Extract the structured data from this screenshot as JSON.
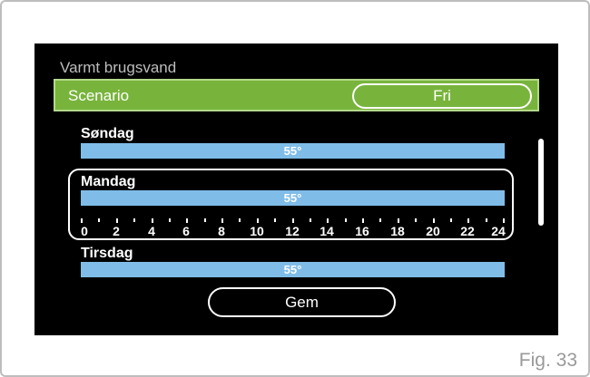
{
  "screen": {
    "title": "Varmt brugsvand",
    "scenario": {
      "label": "Scenario",
      "value": "Fri"
    },
    "days": [
      {
        "name": "Søndag",
        "temp": "55°"
      },
      {
        "name": "Mandag",
        "temp": "55°"
      },
      {
        "name": "Tirsdag",
        "temp": "55°"
      }
    ],
    "timeline_labels": [
      "0",
      "2",
      "4",
      "6",
      "8",
      "10",
      "12",
      "14",
      "16",
      "18",
      "20",
      "22",
      "24"
    ],
    "save_label": "Gem"
  },
  "figure_label": "Fig. 33"
}
